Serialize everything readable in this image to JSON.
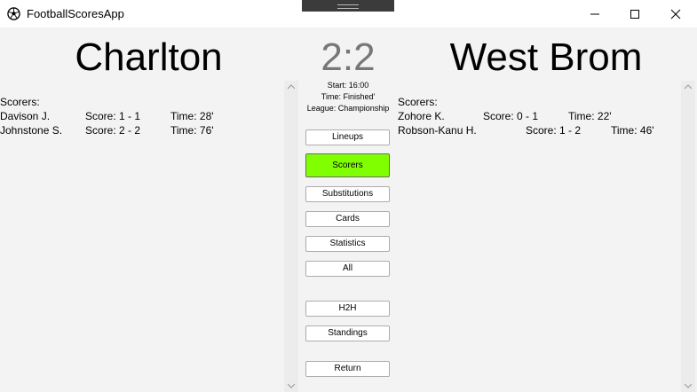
{
  "window": {
    "title": "FootballScoresApp"
  },
  "match": {
    "home_team": "Charlton",
    "away_team": "West Brom",
    "score": "2:2",
    "start": "Start: 16:00",
    "time": "Time: Finished'",
    "league": "League: Championship"
  },
  "home_scorers": {
    "header": "Scorers:",
    "rows": [
      {
        "name": "Davison J.",
        "score": "Score: 1 - 1",
        "time": "Time: 28'"
      },
      {
        "name": "Johnstone S.",
        "score": "Score: 2 - 2",
        "time": "Time: 76'"
      }
    ]
  },
  "away_scorers": {
    "header": "Scorers:",
    "rows": [
      {
        "name": "Zohore K.",
        "score": "Score: 0 - 1",
        "time": "Time: 22'"
      },
      {
        "name": "Robson-Kanu H.",
        "score": "Score: 1 - 2",
        "time": "Time: 46'"
      }
    ]
  },
  "buttons": {
    "lineups": "Lineups",
    "scorers": "Scorers",
    "substitutions": "Substitutions",
    "cards": "Cards",
    "statistics": "Statistics",
    "all": "All",
    "h2h": "H2H",
    "standings": "Standings",
    "return": "Return"
  },
  "colors": {
    "active_button": "#80ff00",
    "score": "#777777"
  },
  "icons": {
    "app": "soccer-ball-icon",
    "minimize": "minimize-icon",
    "maximize": "maximize-icon",
    "close": "close-icon"
  }
}
